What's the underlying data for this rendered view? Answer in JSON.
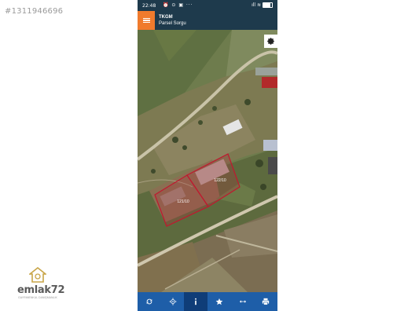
{
  "watermark": {
    "listing_id": "#1311946696"
  },
  "logo": {
    "name": "emlak72",
    "tagline": "GAYRIMENKUL DANIŞMANLIK"
  },
  "status_bar": {
    "time": "22:48",
    "left_icons": "⏰ ⊙ ▣ ···",
    "right_icons": "ıll ≋"
  },
  "app_header": {
    "title": "TKGM",
    "subtitle": "Parsel Sorgu"
  },
  "map": {
    "parcels": [
      {
        "label": "121/10"
      },
      {
        "label": "122/10"
      }
    ],
    "parcel_border_color": "#c0182f"
  },
  "bottom_nav": {
    "items": [
      {
        "icon": "refresh-icon"
      },
      {
        "icon": "locate-icon"
      },
      {
        "icon": "info-icon",
        "active": true
      },
      {
        "icon": "star-icon"
      },
      {
        "icon": "measure-icon"
      },
      {
        "icon": "print-icon"
      }
    ]
  },
  "colors": {
    "header": "#1e3a4c",
    "menu_button": "#f07b2d",
    "bottom_bar": "#1e5ea8",
    "active_tab": "#0f3d78"
  }
}
